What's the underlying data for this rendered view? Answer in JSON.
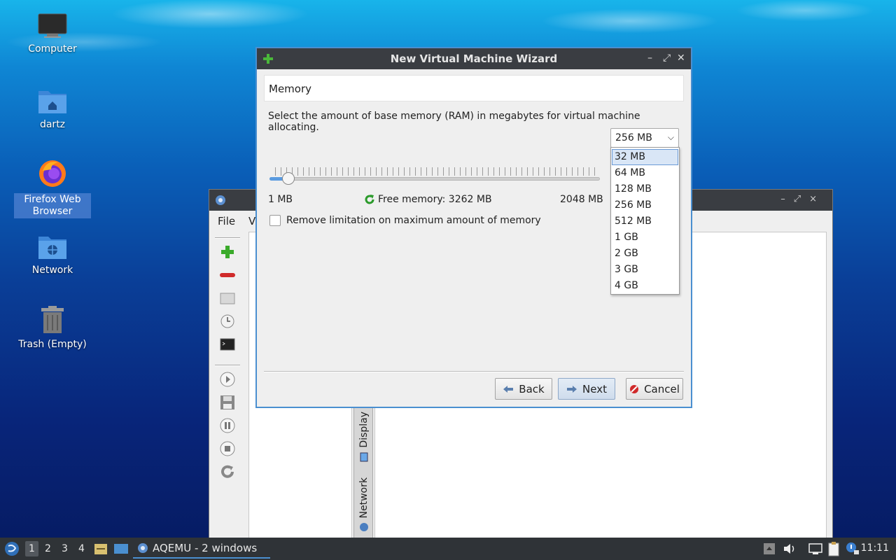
{
  "desktop": {
    "icons": [
      {
        "label": "Computer",
        "icon": "computer-icon"
      },
      {
        "label": "dartz",
        "icon": "home-folder-icon"
      },
      {
        "label": "Firefox Web Browser",
        "icon": "firefox-icon",
        "selected": true
      },
      {
        "label": "Network",
        "icon": "network-folder-icon"
      },
      {
        "label": "Trash (Empty)",
        "icon": "trash-icon"
      }
    ]
  },
  "aqemu": {
    "menu": [
      "File",
      "V"
    ],
    "tabs": {
      "display": "Display",
      "network": "Network"
    }
  },
  "dialog": {
    "title": "New Virtual Machine Wizard",
    "page_title": "Memory",
    "description": "Select the amount of base memory (RAM) in megabytes for virtual machine allocating.",
    "combo_value": "256 MB",
    "slider": {
      "min_label": "1 MB",
      "max_label": "2048 MB",
      "value_fraction": 0.04
    },
    "free_memory": "Free memory: 3262 MB",
    "checkbox_label": "Remove limitation on maximum amount of memory",
    "checkbox_checked": false,
    "buttons": {
      "back": "Back",
      "next": "Next",
      "cancel": "Cancel"
    }
  },
  "dropdown": {
    "options": [
      "32 MB",
      "64 MB",
      "128 MB",
      "256 MB",
      "512 MB",
      "1 GB",
      "2 GB",
      "3 GB",
      "4 GB"
    ],
    "highlighted_index": 0
  },
  "taskbar": {
    "workspaces": [
      "1",
      "2",
      "3",
      "4"
    ],
    "active_workspace": "1",
    "task_label": "AQEMU - 2 windows",
    "clock": "11:11"
  },
  "colors": {
    "accent": "#4a8fd0",
    "titlebar": "#3a3d42",
    "taskbar": "#2f3337"
  }
}
